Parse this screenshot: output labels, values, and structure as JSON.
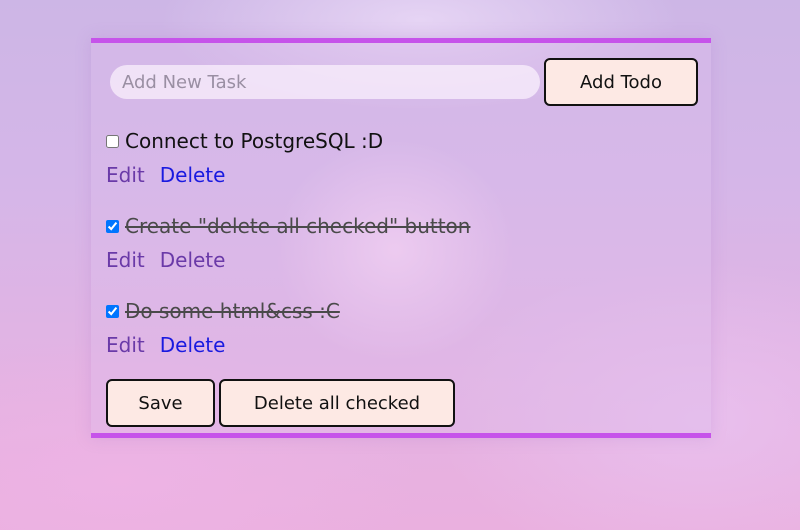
{
  "input": {
    "placeholder": "Add New Task",
    "value": ""
  },
  "buttons": {
    "add_label": "Add Todo",
    "save_label": "Save",
    "delete_all_label": "Delete all checked"
  },
  "todos": [
    {
      "text": "Connect to PostgreSQL :D",
      "checked": false,
      "edit_label": "Edit",
      "delete_label": "Delete"
    },
    {
      "text": "Create \"delete all checked\" button",
      "checked": true,
      "edit_label": "Edit",
      "delete_label": "Delete"
    },
    {
      "text": "Do some html&css :C",
      "checked": true,
      "edit_label": "Edit",
      "delete_label": "Delete"
    }
  ],
  "colors": {
    "accent_border": "#c653ea",
    "button_bg": "#fde9e4",
    "edit_link": "#6a3aa8",
    "delete_link": "#1a1ae0"
  }
}
